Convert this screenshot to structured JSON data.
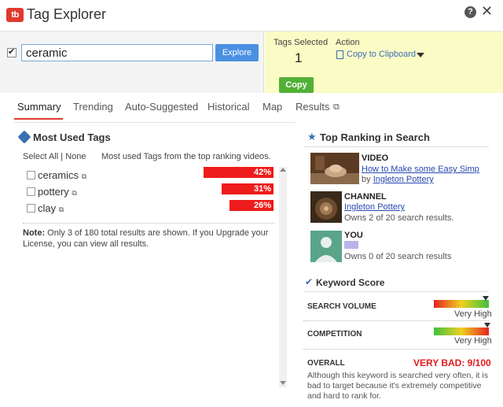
{
  "app": {
    "logo_text": "tb",
    "title": "Tag Explorer",
    "help_label": "?",
    "close_label": "✕"
  },
  "search": {
    "value": "ceramic",
    "explore_label": "Explore",
    "checked": true
  },
  "selection": {
    "tags_selected_label": "Tags Selected",
    "tags_selected_count": "1",
    "action_label": "Action",
    "action_value": "Copy to Clipboard",
    "copy_label": "Copy"
  },
  "tabs": [
    {
      "label": "Summary",
      "active": true
    },
    {
      "label": "Trending"
    },
    {
      "label": "Auto-Suggested"
    },
    {
      "label": "Historical"
    },
    {
      "label": "Map"
    },
    {
      "label": "Results"
    }
  ],
  "most_used": {
    "title": "Most Used Tags",
    "select_all": "Select All | None",
    "description": "Most used Tags from the top ranking videos.",
    "tags": [
      {
        "label": "ceramics",
        "percent": 42,
        "percent_label": "42%"
      },
      {
        "label": "pottery",
        "percent": 31,
        "percent_label": "31%"
      },
      {
        "label": "clay",
        "percent": 26,
        "percent_label": "26%"
      }
    ],
    "note_bold": "Note:",
    "note_text": " Only 3 of 180 total results are shown. If you Upgrade your License, you can view all results."
  },
  "top_ranking": {
    "title": "Top Ranking in Search",
    "video": {
      "type": "VIDEO",
      "title": "How to Make some Easy Simp...",
      "by": "by ",
      "channel": "Ingleton Pottery"
    },
    "channel": {
      "type": "CHANNEL",
      "name": "Ingleton Pottery",
      "owns": "Owns 2 of 20 search results."
    },
    "you": {
      "type": "YOU",
      "owns": "Owns 0 of 20 search results"
    }
  },
  "keyword_score": {
    "title": "Keyword Score",
    "search_volume_label": "SEARCH VOLUME",
    "search_volume_value": "Very High",
    "competition_label": "COMPETITION",
    "competition_value": "Very High",
    "overall_label": "OVERALL",
    "overall_value": "VERY BAD: 9/100",
    "overall_text": "Although this keyword is searched very often, it is bad to target because it's extremely competitive and hard to rank for."
  },
  "colors": {
    "accent_blue": "#4a90e2",
    "bar_red": "#ee1c1c",
    "copy_green": "#52b035",
    "selection_yellow": "#fbfbc6",
    "bad_red": "#e01b1b"
  }
}
